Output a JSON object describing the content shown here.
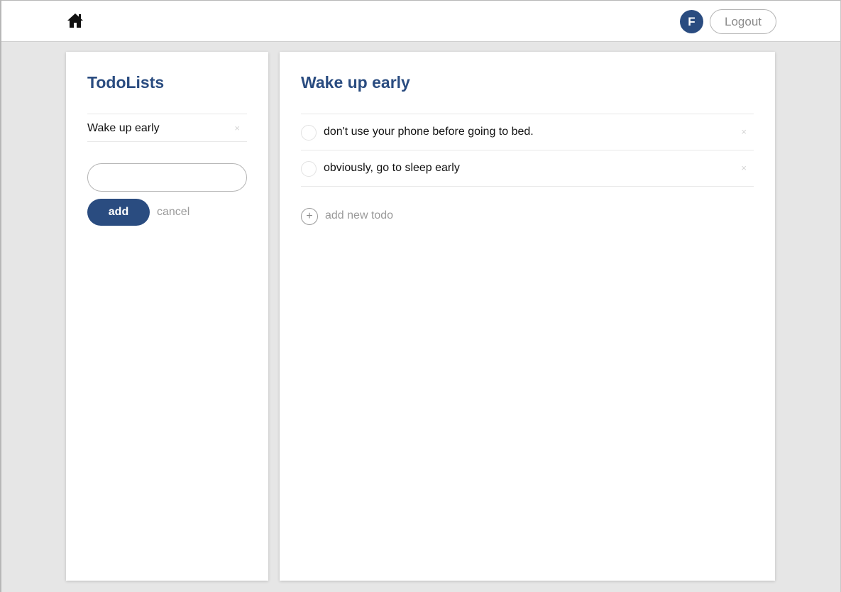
{
  "navbar": {
    "home_icon": "home-icon",
    "avatar_initial": "F",
    "logout_label": "Logout",
    "accent_color": "#2a4c80"
  },
  "sidebar": {
    "title": "TodoLists",
    "lists": [
      {
        "label": "Wake up early",
        "delete_glyph": "×"
      }
    ],
    "new_list_input": {
      "value": "",
      "placeholder": ""
    },
    "add_label": "add",
    "cancel_label": "cancel"
  },
  "main": {
    "title": "Wake up early",
    "todos": [
      {
        "text": "don't use your phone before going to bed.",
        "done": false,
        "delete_glyph": "×"
      },
      {
        "text": "obviously, go to sleep early",
        "done": false,
        "delete_glyph": "×"
      }
    ],
    "add_todo_icon": "plus-circle-icon",
    "add_todo_glyph": "+",
    "add_todo_label": "add new todo"
  }
}
